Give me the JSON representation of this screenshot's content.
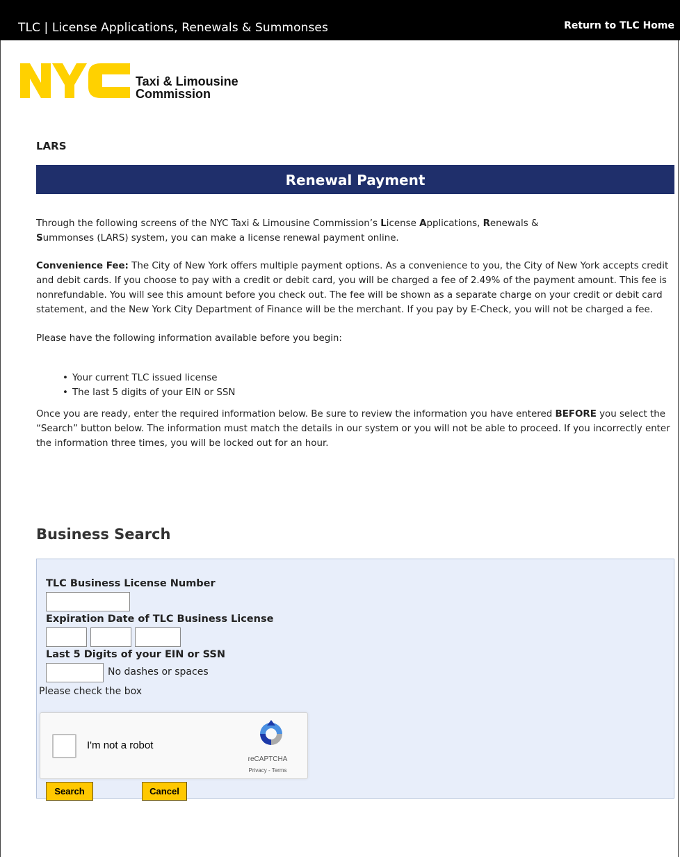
{
  "topbar": {
    "title": "TLC | License Applications, Renewals & Summonses",
    "home_link": "Return to TLC Home"
  },
  "logo": {
    "mark": "NYC",
    "agency_line1": "Taxi & Limousine",
    "agency_line2": "Commission",
    "brand_color": "#FFD100"
  },
  "system_label": "LARS",
  "banner": {
    "title": "Renewal Payment",
    "color": "#1F2F6B"
  },
  "intro": {
    "p1_a": "Through the following screens of the NYC Taxi & Limousine Commission’s ",
    "p1_L": "L",
    "p1_b": "icense ",
    "p1_A": "A",
    "p1_c": "pplications, ",
    "p1_R": "R",
    "p1_d": "enewals &",
    "p1_S": "S",
    "p1_e": "ummonses (LARS) system, you can make a license renewal payment online.",
    "fee_label": "Convenience Fee:",
    "fee_text": " The City of New York offers multiple payment options. As a convenience to you, the City of New York accepts credit and debit cards. If you choose to pay with a credit or debit card, you will be charged a fee of 2.49% of the payment amount. This fee is nonrefundable. You will see this amount before you check out. The fee will be shown as a separate charge on your credit or debit card statement, and the New York City Department of Finance will be the merchant. If you pay by E-Check, you will not be charged a fee.",
    "prep": "Please have the following information available before you begin:",
    "bullets": [
      "Your current TLC issued license",
      "The last 5 digits of your EIN or SSN"
    ],
    "ready_a": "Once you are ready, enter the required information below. Be sure to review the information you have entered ",
    "ready_bold": "BEFORE",
    "ready_b": " you select the “Search” button below. The information must match the details in our system or you will not be able to proceed. If you incorrectly enter the information three times, you will be locked out for an hour."
  },
  "search": {
    "heading": "Business Search",
    "license_label": "TLC Business License Number",
    "license_value": "",
    "expiration_label": "Expiration Date of TLC Business License",
    "exp_month": "",
    "exp_day": "",
    "exp_year": "",
    "ein_label": "Last 5 Digits of your EIN or SSN",
    "ein_value": "",
    "ein_hint": "No dashes or spaces",
    "check_prompt": "Please check the box",
    "panel_color": "#E8EEFA"
  },
  "recaptcha": {
    "label": "I'm not a robot",
    "brand": "reCAPTCHA",
    "terms": "Privacy - Terms",
    "icon": "recaptcha-logo"
  },
  "buttons": {
    "search": "Search",
    "cancel": "Cancel",
    "color": "#FFC800"
  }
}
